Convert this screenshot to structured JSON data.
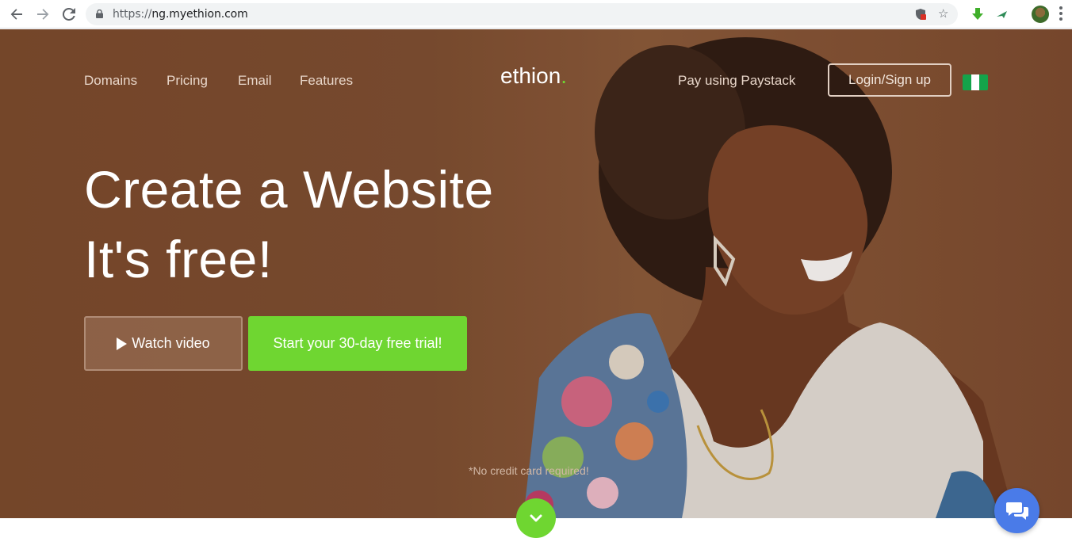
{
  "browser": {
    "url_scheme": "https://",
    "url_host": "ng.myethion.com"
  },
  "nav": {
    "links": [
      "Domains",
      "Pricing",
      "Email",
      "Features"
    ],
    "logo_text": "ethion",
    "logo_dot": ".",
    "pay_link": "Pay using Paystack",
    "login_label": "Login/Sign up"
  },
  "hero": {
    "headline_line1": "Create a Website",
    "headline_line2": "It's free!",
    "watch_label": "Watch video",
    "trial_label": "Start your 30-day free trial!",
    "note": "*No credit card required!"
  },
  "colors": {
    "accent_green": "#6fd631",
    "chat_blue": "#4a7be8",
    "hero_brown": "#7d4e31"
  },
  "icons": {
    "back": "arrow-left-icon",
    "forward": "arrow-right-icon",
    "reload": "reload-icon",
    "lock": "lock-icon",
    "star": "star-icon",
    "play": "play-icon",
    "chevron": "chevron-down-icon",
    "chat": "chat-bubbles-icon",
    "flag": "nigeria-flag-icon"
  }
}
